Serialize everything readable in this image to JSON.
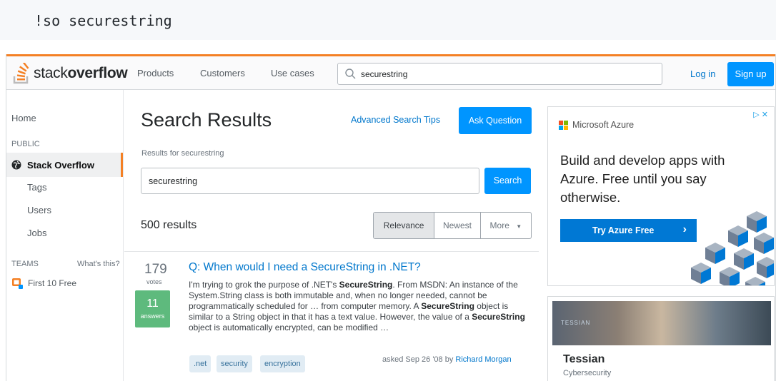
{
  "command": "!so securestring",
  "topbar": {
    "logo_light": "stack",
    "logo_bold": "overflow",
    "nav": [
      "Products",
      "Customers",
      "Use cases"
    ],
    "search_value": "securestring",
    "login": "Log in",
    "signup": "Sign up",
    "accent_color": "#f48024",
    "primary_color": "#0095ff"
  },
  "sidebar": {
    "home": "Home",
    "public_heading": "PUBLIC",
    "stack_overflow": "Stack Overflow",
    "tags": "Tags",
    "users": "Users",
    "jobs": "Jobs",
    "teams_heading": "TEAMS",
    "whats_this": "What's this?",
    "first_free": "First 10 Free"
  },
  "main": {
    "title": "Search Results",
    "advanced_tips": "Advanced Search Tips",
    "ask_question": "Ask Question",
    "results_for": "Results for securestring",
    "query": "securestring",
    "search_button": "Search",
    "result_count": "500 results",
    "sort_tabs": [
      "Relevance",
      "Newest",
      "More"
    ],
    "active_sort": "Relevance"
  },
  "question": {
    "votes": "179",
    "votes_label": "votes",
    "answers": "11",
    "answers_label": "answers",
    "title": "Q: When would I need a SecureString in .NET?",
    "excerpt_parts": [
      {
        "t": "I'm trying to grok the purpose of .NET's ",
        "b": false
      },
      {
        "t": "SecureString",
        "b": true
      },
      {
        "t": ". From MSDN: An instance of the System.String class is both immutable and, when no longer needed, cannot be programmatically scheduled for … from computer memory. A ",
        "b": false
      },
      {
        "t": "SecureString",
        "b": true
      },
      {
        "t": " object is similar to a String object in that it has a text value. However, the value of a ",
        "b": false
      },
      {
        "t": "SecureString",
        "b": true
      },
      {
        "t": " object is automatically encrypted, can be modified …",
        "b": false
      }
    ],
    "tags": [
      ".net",
      "security",
      "encryption"
    ],
    "asked": "asked Sep 26 '08 by",
    "author": "Richard Morgan"
  },
  "ad": {
    "brand": "Microsoft Azure",
    "close": "▷ ✕",
    "headline": "Build and develop apps with Azure. Free until you say otherwise.",
    "button": "Try Azure Free",
    "button_arrow": "›",
    "color": "#0078d4"
  },
  "company_card": {
    "logo_text": "TESSIAN",
    "name": "Tessian",
    "industry": "Cybersecurity"
  }
}
